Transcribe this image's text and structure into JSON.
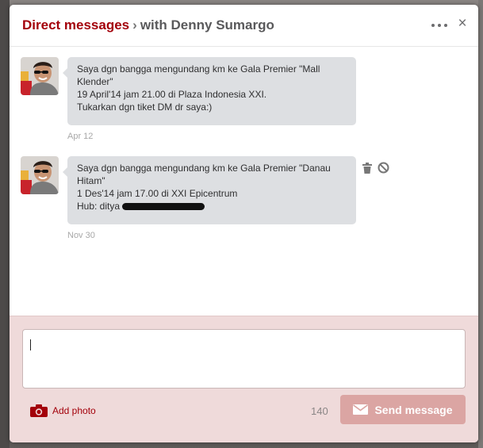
{
  "header": {
    "title_main": "Direct messages",
    "title_separator": "›",
    "title_with": "with Denny Sumargo",
    "more_icon": "ellipsis-icon",
    "close_label": "×"
  },
  "messages": [
    {
      "sender": "Denny Sumargo",
      "lines": [
        "Saya dgn bangga mengundang km ke Gala Premier \"Mall Klender\"",
        "19 April'14 jam 21.00 di Plaza Indonesia XXI.",
        "Tukarkan dgn tiket DM dr saya:)"
      ],
      "date": "Apr 12"
    },
    {
      "sender": "Denny Sumargo",
      "lines": [
        "Saya dgn bangga mengundang km ke Gala Premier \"Danau Hitam\"",
        "1 Des'14 jam 17.00 di XXI Epicentrum",
        "Hub: ditya"
      ],
      "date": "Nov 30",
      "actions": [
        "trash-icon",
        "block-icon"
      ]
    }
  ],
  "composer": {
    "text_value": "",
    "add_photo_label": "Add photo",
    "char_count": "140",
    "send_label": "Send message"
  },
  "colors": {
    "brand_red": "#a3000a",
    "bubble_bg": "#dddfe2",
    "composer_bg": "#efdada",
    "send_disabled": "#dba5a3"
  }
}
